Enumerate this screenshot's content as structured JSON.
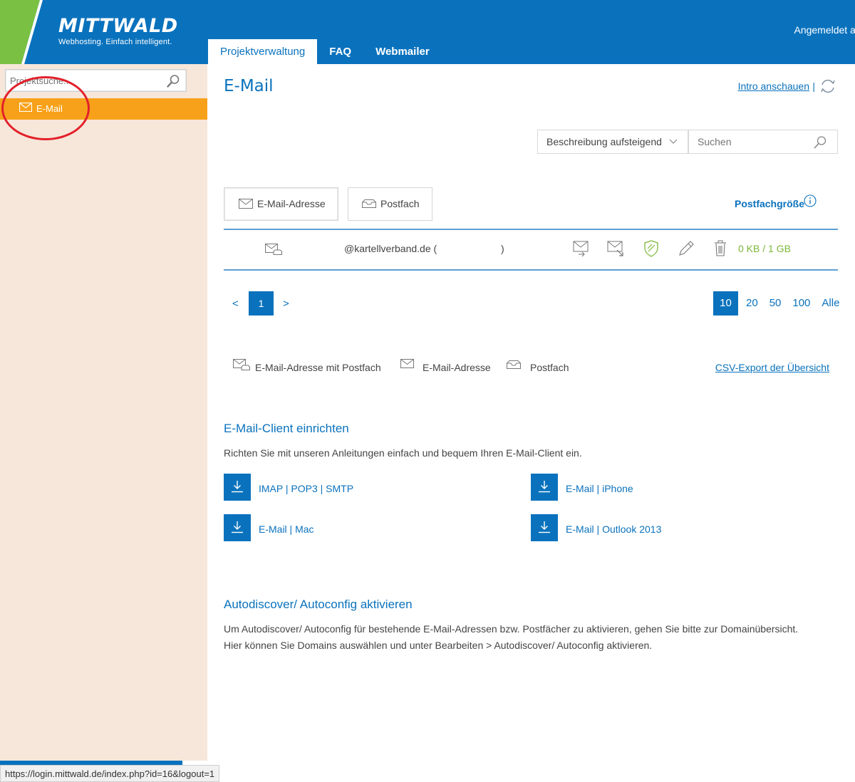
{
  "header": {
    "logo_title": "MITTWALD",
    "logo_subtitle": "Webhosting. Einfach intelligent.",
    "logged_in": "Angemeldet al",
    "nav": [
      {
        "label": "Projektverwaltung",
        "active": true
      },
      {
        "label": "FAQ",
        "active": false
      },
      {
        "label": "Webmailer",
        "active": false
      }
    ]
  },
  "sidebar": {
    "search_placeholder": "Projektsuche...",
    "items": [
      {
        "label": "E-Mail",
        "icon": "envelope-icon",
        "active": true
      }
    ]
  },
  "main": {
    "title": "E-Mail",
    "intro_link": "Intro anschauen",
    "intro_sep": "|",
    "sort_label": "Beschreibung aufsteigend",
    "search_placeholder": "Suchen",
    "buttons": {
      "email_address": "E-Mail-Adresse",
      "postfach": "Postfach"
    },
    "postfach_size_label": "Postfachgröße",
    "rows": [
      {
        "address": "@kartellverband.de (",
        "address_end": ")",
        "usage": "0 KB / 1 GB"
      }
    ],
    "pagination": {
      "prev": "<",
      "current": "1",
      "next": ">",
      "per_page": [
        "10",
        "20",
        "50",
        "100",
        "Alle"
      ],
      "per_page_active": "10"
    },
    "legend": {
      "mail_with_box": "E-Mail-Adresse mit Postfach",
      "mail_address": "E-Mail-Adresse",
      "box": "Postfach"
    },
    "csv_export": "CSV-Export der Übersicht",
    "client_setup": {
      "heading": "E-Mail-Client einrichten",
      "description": "Richten Sie mit unseren Anleitungen einfach und bequem Ihren E-Mail-Client ein.",
      "downloads": [
        "IMAP | POP3 | SMTP",
        "E-Mail | iPhone",
        "E-Mail | Mac",
        "E-Mail | Outlook 2013"
      ]
    },
    "autodiscover": {
      "heading": "Autodiscover/ Autoconfig aktivieren",
      "line1": "Um Autodiscover/ Autoconfig für bestehende E-Mail-Adressen bzw. Postfächer zu aktivieren, gehen Sie bitte zur Domainübersicht.",
      "line2": "Hier können Sie Domains auswählen und unter Bearbeiten > Autodiscover/ Autoconfig aktivieren."
    }
  },
  "statusbar": {
    "url": "https://login.mittwald.de/index.php?id=16&logout=1"
  },
  "colors": {
    "brand_blue": "#0a72bd",
    "accent_orange": "#f7a11a",
    "brand_green": "#7ac143",
    "usage_green": "#7cb63a",
    "sidebar_bg": "#f6e7da",
    "annotation_red": "#e3202a"
  }
}
